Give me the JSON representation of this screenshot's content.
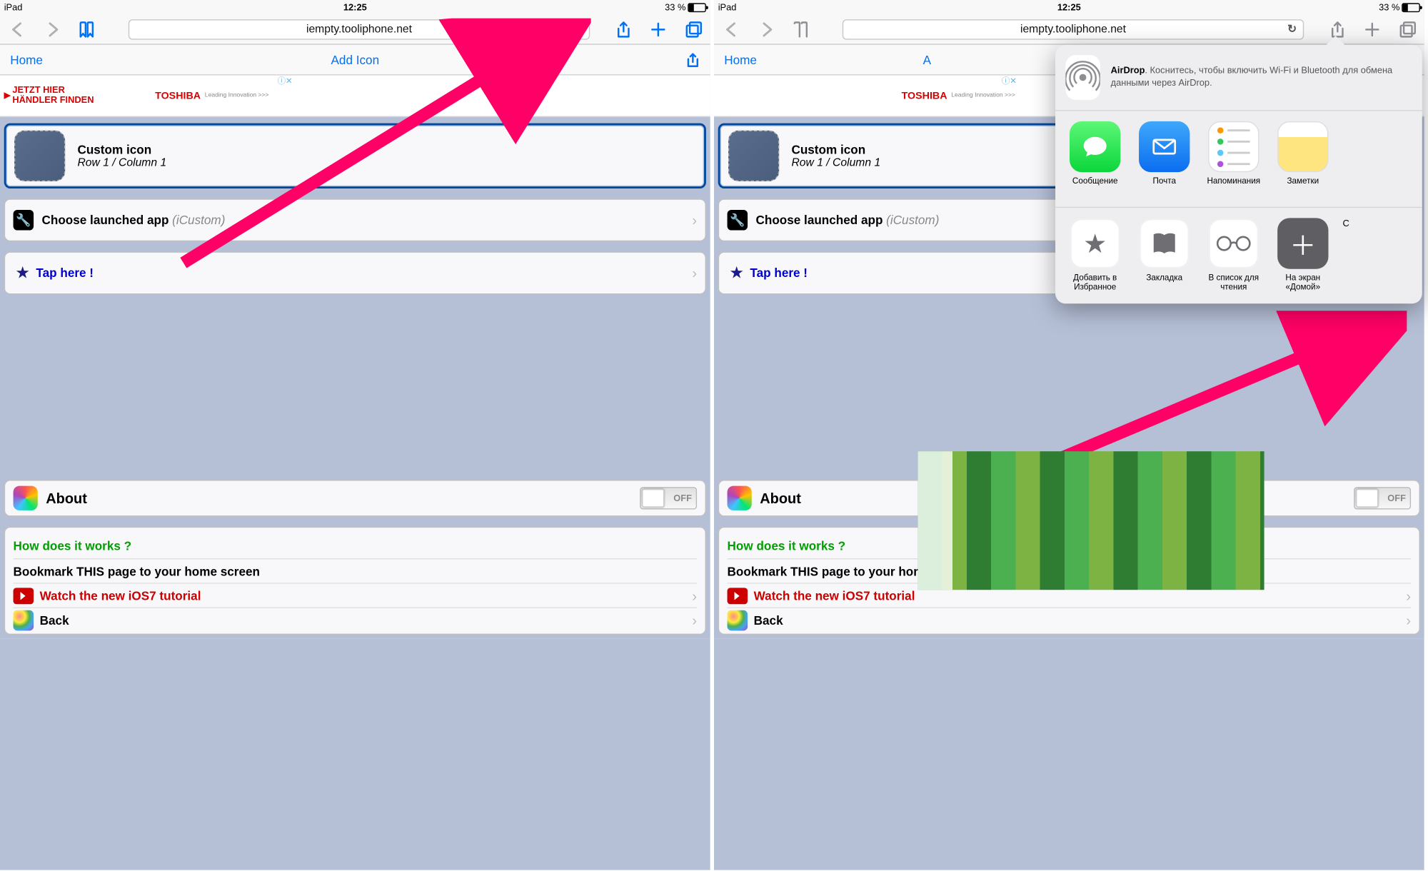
{
  "status": {
    "device": "iPad",
    "time": "12:25",
    "battery": "33 %"
  },
  "toolbar": {
    "url": "iempty.tooliphone.net"
  },
  "page": {
    "home": "Home",
    "title": "Add Icon",
    "banner_jetzt_l1": "JETZT HIER",
    "banner_jetzt_l2": "HÄNDLER FINDEN",
    "banner_brand": "TOSHIBA",
    "banner_tag": "Leading Innovation >>>",
    "custom_title": "Custom icon",
    "custom_pos": "Row 1 / Column 1",
    "choose_label": "Choose launched app ",
    "choose_hint": "(iCustom)",
    "tap_here": "Tap here !",
    "about": "About",
    "switch_label": "OFF",
    "how_title": "How does it works ?",
    "bookmark_line": "Bookmark THIS page to your home screen",
    "watch_line": "Watch the new iOS7 tutorial",
    "back_line": "Back"
  },
  "share": {
    "airdrop_bold": "AirDrop",
    "airdrop_rest": ". Коснитесь, чтобы включить Wi-Fi и Bluetooth для обмена данными через AirDrop.",
    "items": [
      {
        "label": "Сообщение",
        "color": "linear-gradient(#5df777,#0bd63b)",
        "glyph": "message"
      },
      {
        "label": "Почта",
        "color": "linear-gradient(#3fa8fb,#0b6df0)",
        "glyph": "mail"
      },
      {
        "label": "Напоминания",
        "color": "#fff",
        "glyph": "reminders"
      },
      {
        "label": "Заметки",
        "color": "linear-gradient(#fff 0 30%, #ffe57f 30% 100%)",
        "glyph": "notes"
      }
    ],
    "actions": [
      {
        "label_l1": "Добавить в",
        "label_l2": "Избранное",
        "glyph": "star"
      },
      {
        "label_l1": "Закладка",
        "label_l2": "",
        "glyph": "book"
      },
      {
        "label_l1": "В список для",
        "label_l2": "чтения",
        "glyph": "glasses"
      },
      {
        "label_l1": "На экран",
        "label_l2": "«Домой»",
        "glyph": "plus"
      }
    ],
    "more_letter": "С"
  }
}
